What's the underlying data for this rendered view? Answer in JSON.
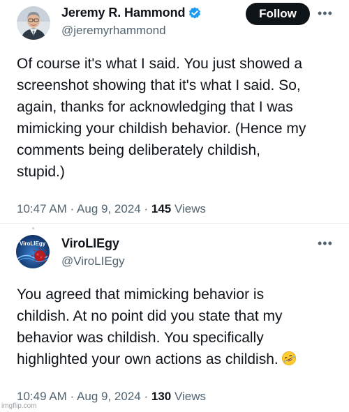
{
  "tweets": [
    {
      "author": {
        "display_name": "Jeremy R. Hammond",
        "handle": "@jeremyrhammond",
        "verified": true
      },
      "follow_label": "Follow",
      "more_label": "•••",
      "text_lines": [
        "Of course it's what I said. You just showed a",
        "screenshot showing that it's what I said. So,",
        "again, thanks for acknowledging that I was",
        "mimicking your childish behavior. (Hence my",
        "comments being deliberately childish,",
        "stupid.)"
      ],
      "time": "10:47 AM",
      "date": "Aug 9, 2024",
      "views_count": "145",
      "views_label": "Views"
    },
    {
      "author": {
        "display_name": "ViroLIEgy",
        "handle": "@ViroLIEgy",
        "verified": false,
        "avatar_text": "ViroLIEgy"
      },
      "more_label": "•••",
      "text_lines": [
        "You agreed that mimicking behavior is",
        "childish. At no point did you state that my",
        "behavior was childish. You specifically",
        "highlighted your own actions as childish."
      ],
      "emoji": "rolling-on-floor-laughing",
      "time": "10:49 AM",
      "date": "Aug 9, 2024",
      "views_count": "130",
      "views_label": "Views"
    }
  ],
  "separator": "·",
  "watermark": "imgflip.com",
  "colors": {
    "text": "#0f1419",
    "secondary": "#536471",
    "verified": "#1d9bf0",
    "follow_bg": "#0f1419"
  }
}
